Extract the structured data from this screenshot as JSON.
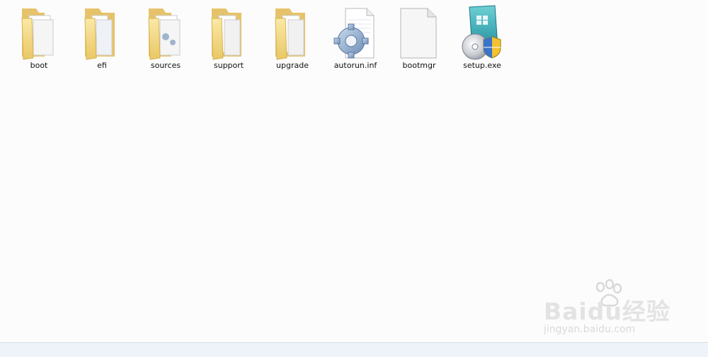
{
  "window": {
    "status_bar": ""
  },
  "files": [
    {
      "name": "boot",
      "icon": "folder-icon"
    },
    {
      "name": "efi",
      "icon": "folder-icon"
    },
    {
      "name": "sources",
      "icon": "folder-icon"
    },
    {
      "name": "support",
      "icon": "folder-icon"
    },
    {
      "name": "upgrade",
      "icon": "folder-icon"
    },
    {
      "name": "autorun.inf",
      "icon": "settings-file-icon"
    },
    {
      "name": "bootmgr",
      "icon": "blank-file-icon"
    },
    {
      "name": "setup.exe",
      "icon": "setup-exe-icon"
    }
  ],
  "watermark": {
    "logo": "Baidu经验",
    "url": "jingyan.baidu.com"
  },
  "colors": {
    "folder": "#f3d98a",
    "background": "#fcfcfc",
    "status_bar": "#eef3fa"
  }
}
